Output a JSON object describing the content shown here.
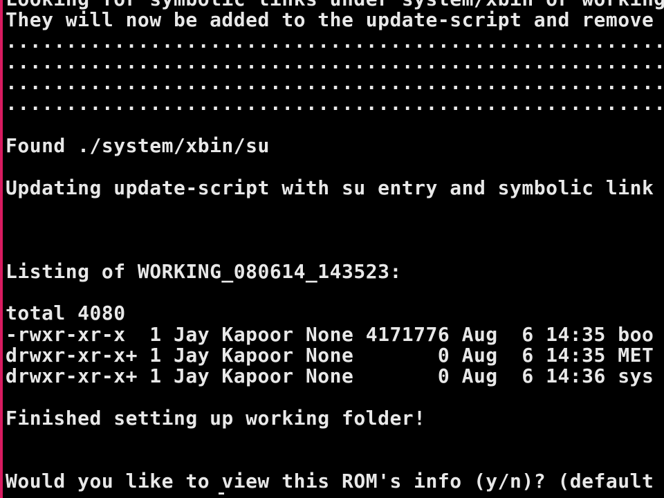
{
  "terminal": {
    "border_color": "#d81b60",
    "text_color": "#e8e8e8",
    "background": "#000000",
    "lines": [
      "Looking for symbolic links under system/xbin or working",
      "They will now be added to the update-script and remove",
      "...............................................................",
      "...............................................................",
      "...............................................................",
      "...............................................................",
      "",
      "Found ./system/xbin/su",
      "",
      "Updating update-script with su entry and symbolic link",
      "",
      "",
      "",
      "Listing of WORKING_080614_143523:",
      "",
      "total 4080",
      "-rwxr-xr-x  1 Jay Kapoor None 4171776 Aug  6 14:35 boo",
      "drwxr-xr-x+ 1 Jay Kapoor None       0 Aug  6 14:35 MET",
      "drwxr-xr-x+ 1 Jay Kapoor None       0 Aug  6 14:36 sys",
      "",
      "Finished setting up working folder!",
      "",
      "",
      "Would you like to view this ROM's info (y/n)? (default"
    ]
  }
}
